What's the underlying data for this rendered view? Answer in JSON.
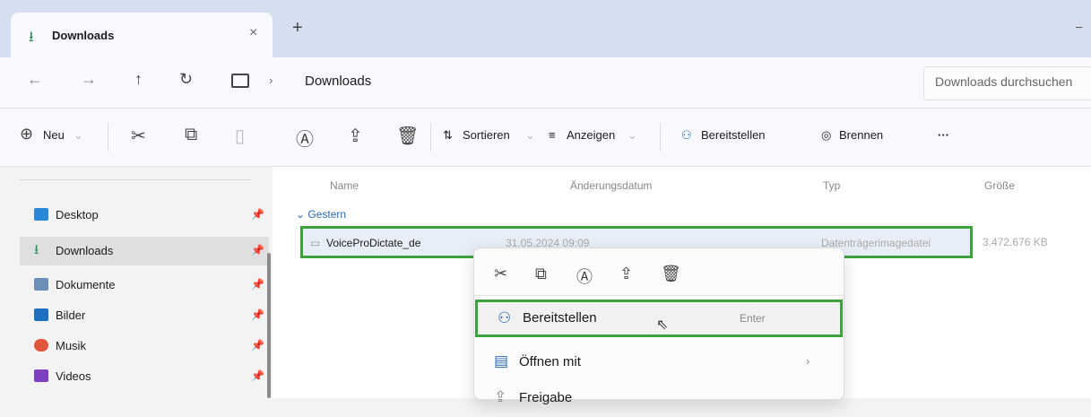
{
  "tab": {
    "title": "Downloads",
    "close": "×",
    "new_tab": "+",
    "minimize": "–"
  },
  "nav": {
    "back": "←",
    "forward": "→",
    "up": "↑",
    "refresh": "↻",
    "sep": "›",
    "location": "Downloads"
  },
  "search": {
    "placeholder": "Downloads durchsuchen"
  },
  "toolbar": {
    "new_label": "Neu",
    "sort_label": "Sortieren",
    "view_label": "Anzeigen",
    "share_label": "Bereitstellen",
    "burn_label": "Brennen",
    "more_label": "···"
  },
  "sidebar": {
    "items": [
      {
        "label": "Desktop",
        "icon": "desktop-icon",
        "color": "#2b88d8"
      },
      {
        "label": "Downloads",
        "icon": "download-icon",
        "color": "#2e8b57"
      },
      {
        "label": "Dokumente",
        "icon": "documents-icon",
        "color": "#6b8fb5"
      },
      {
        "label": "Bilder",
        "icon": "pictures-icon",
        "color": "#1e6fc1"
      },
      {
        "label": "Musik",
        "icon": "music-icon",
        "color": "#e1553f"
      },
      {
        "label": "Videos",
        "icon": "videos-icon",
        "color": "#7b3fbf"
      }
    ]
  },
  "columns": {
    "name": "Name",
    "date": "Änderungsdatum",
    "type": "Typ",
    "size": "Größe"
  },
  "group": {
    "label": "Gestern"
  },
  "file": {
    "name": "VoiceProDictate_de",
    "date": "31.05.2024 09:09",
    "type": "Datenträgerimagedatei",
    "size": "3.472.676 KB"
  },
  "context_menu": {
    "items": [
      {
        "label": "Bereitstellen",
        "shortcut": "Enter"
      },
      {
        "label": "Öffnen mit"
      },
      {
        "label": "Freigabe"
      }
    ]
  },
  "colors": {
    "highlight": "#3ca33c",
    "tabbar": "#d5dff0"
  }
}
